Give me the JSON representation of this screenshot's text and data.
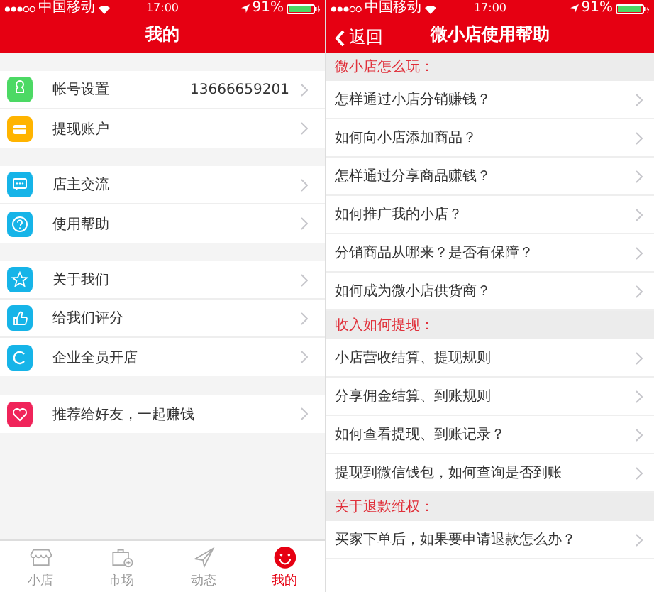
{
  "screens": [
    {
      "kind": "profile",
      "status_bar": {
        "carrier": "中国移动",
        "time": "17:00",
        "battery": "91%"
      },
      "nav": {
        "title": "我的"
      },
      "groups": [
        [
          {
            "label": "帐号设置",
            "value": "13666659201",
            "color": "#4cd964"
          },
          {
            "label": "提现账户",
            "color": "#ffb400"
          }
        ],
        [
          {
            "label": "店主交流",
            "color": "#16b4e8"
          },
          {
            "label": "使用帮助",
            "color": "#16b4e8"
          }
        ],
        [
          {
            "label": "关于我们",
            "color": "#16b4e8"
          },
          {
            "label": "给我们评分",
            "color": "#16b4e8"
          },
          {
            "label": "企业全员开店",
            "color": "#16b4e8"
          }
        ],
        [
          {
            "label": "推荐给好友，一起赚钱",
            "color": "#f0245a"
          }
        ]
      ],
      "tab_bar": [
        {
          "label": "小店",
          "selected": false
        },
        {
          "label": "市场",
          "selected": false
        },
        {
          "label": "动态",
          "selected": false
        },
        {
          "label": "我的",
          "selected": true
        }
      ]
    },
    {
      "kind": "help",
      "status_bar": {
        "carrier": "中国移动",
        "time": "17:00",
        "battery": "91%"
      },
      "nav": {
        "back": "返回",
        "title": "微小店使用帮助"
      },
      "sections": [
        {
          "title": "微小店怎么玩：",
          "items": [
            "怎样通过小店分销赚钱？",
            "如何向小店添加商品？",
            "怎样通过分享商品赚钱？",
            "如何推广我的小店？",
            "分销商品从哪来？是否有保障？",
            "如何成为微小店供货商？"
          ]
        },
        {
          "title": "收入如何提现：",
          "items": [
            "小店营收结算、提现规则",
            "分享佣金结算、到账规则",
            "如何查看提现、到账记录？",
            "提现到微信钱包，如何查询是否到账"
          ]
        },
        {
          "title": "关于退款维权：",
          "items": [
            "买家下单后，如果要申请退款怎么办？"
          ]
        }
      ]
    }
  ]
}
